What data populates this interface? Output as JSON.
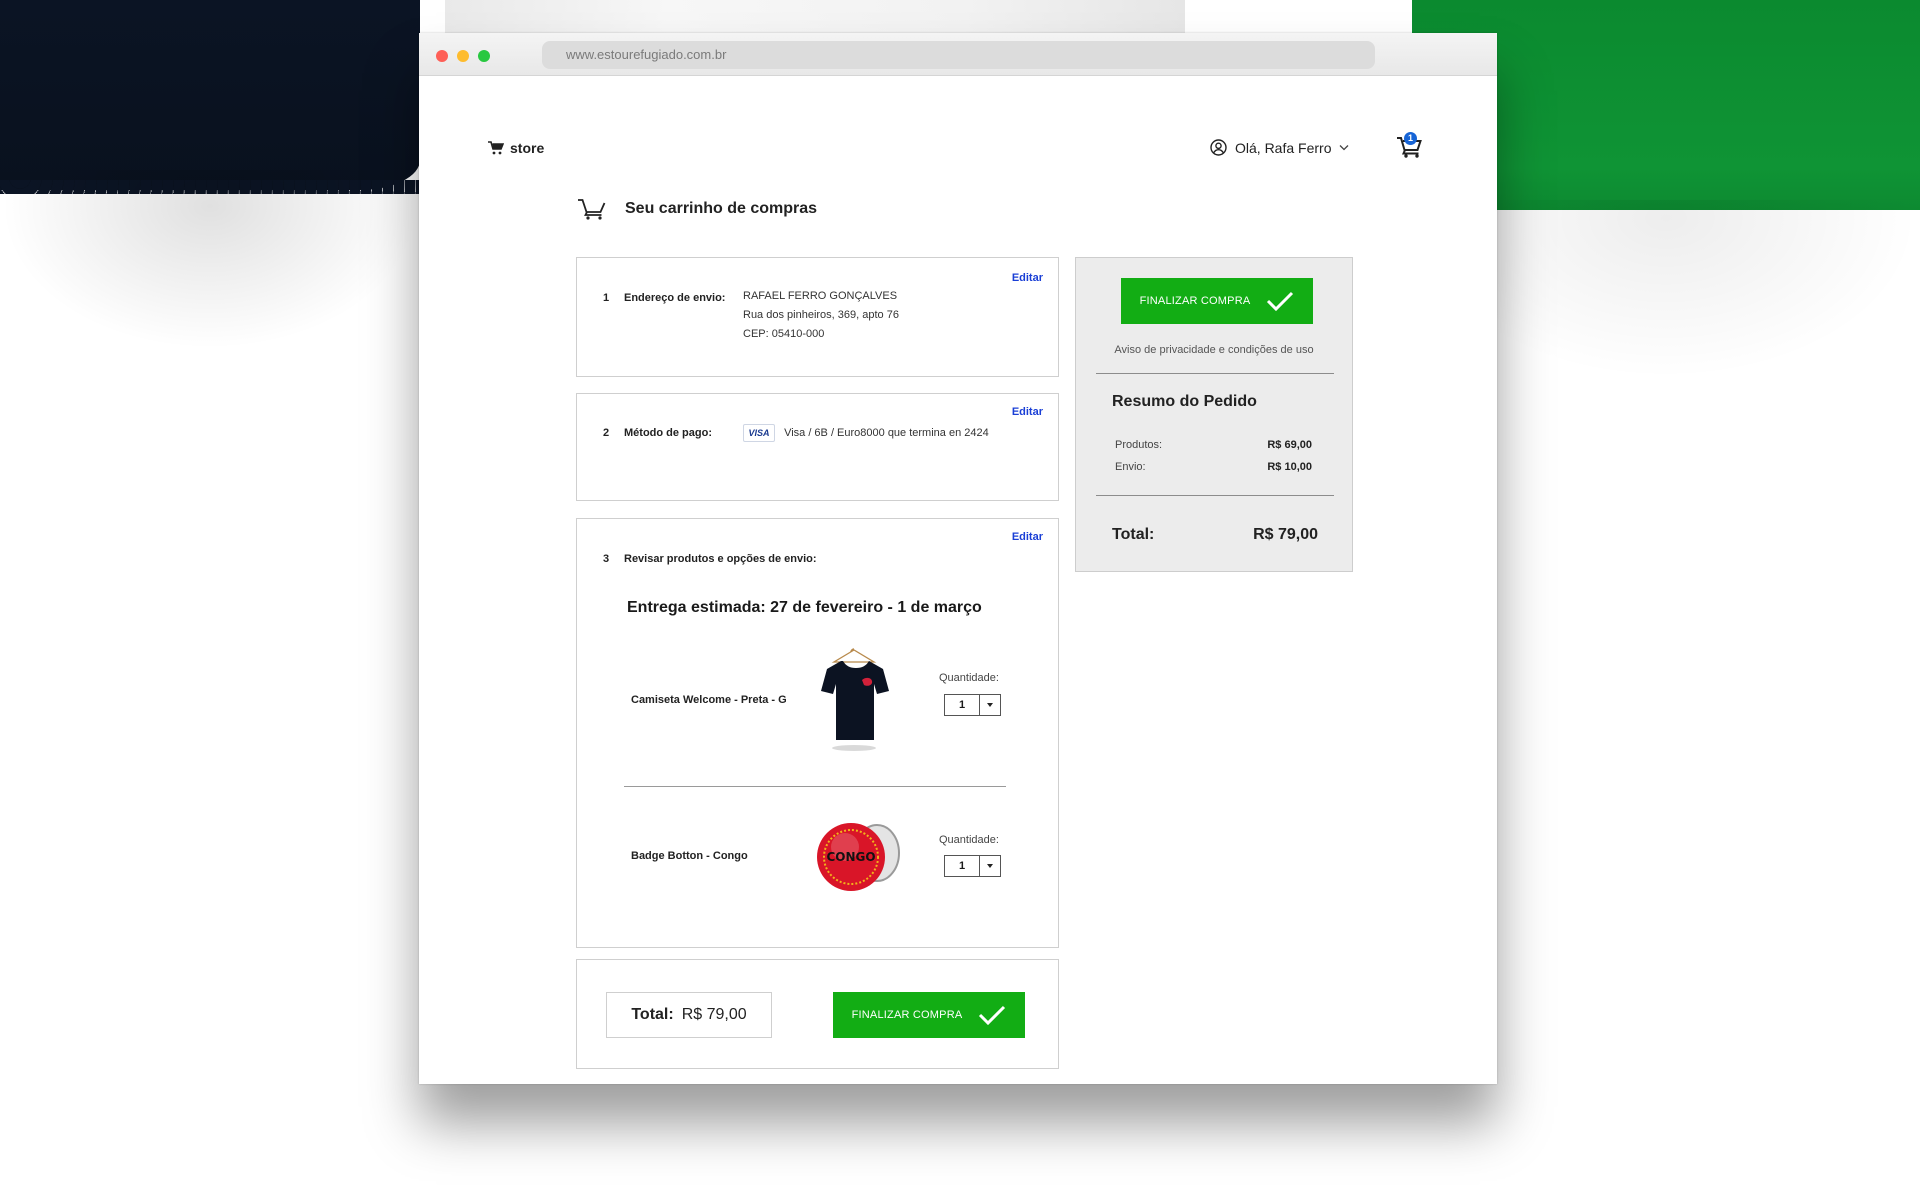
{
  "browser": {
    "url": "www.estourefugiado.com.br"
  },
  "header": {
    "brand": "store",
    "greeting": "Olá, Rafa Ferro",
    "cart_count": "1"
  },
  "page": {
    "title": "Seu carrinho de compras"
  },
  "shipping": {
    "step": "1",
    "label": "Endereço de envio:",
    "edit": "Editar",
    "name": "RAFAEL FERRO GONÇALVES",
    "street": "Rua dos pinheiros, 369, apto 76",
    "cep": "CEP: 05410-000"
  },
  "payment": {
    "step": "2",
    "label": "Método de pago:",
    "edit": "Editar",
    "card_brand": "VISA",
    "card_text": "Visa / 6B / Euro8000 que termina en 2424"
  },
  "review": {
    "step": "3",
    "label": "Revisar produtos e opções de envio:",
    "edit": "Editar",
    "delivery": "Entrega estimada: 27 de fevereiro - 1 de março",
    "products": [
      {
        "name": "Camiseta Welcome - Preta - G",
        "qty_label": "Quantidade:",
        "qty": "1"
      },
      {
        "name": "Badge Botton - Congo",
        "qty_label": "Quantidade:",
        "qty": "1",
        "badge_text": "CONGO"
      }
    ]
  },
  "footer": {
    "total_label": "Total:",
    "total_value": "R$ 79,00",
    "button": "FINALIZAR COMPRA"
  },
  "summary": {
    "button": "FINALIZAR COMPRA",
    "privacy": "Aviso de privacidade e condições de uso",
    "title": "Resumo do Pedido",
    "products_label": "Produtos:",
    "products_value": "R$ 69,00",
    "shipping_label": "Envio:",
    "shipping_value": "R$ 10,00",
    "total_label": "Total:",
    "total_value": "R$ 79,00"
  },
  "colors": {
    "accent_green": "#12ad14",
    "link_blue": "#1a3fd6",
    "badge_blue": "#1664d6"
  }
}
